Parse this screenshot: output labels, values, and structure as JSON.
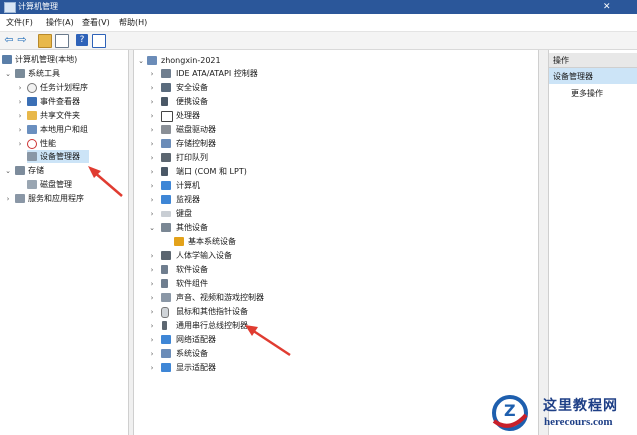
{
  "window": {
    "title": "计算机管理"
  },
  "menu": [
    "文件(F)",
    "操作(A)",
    "查看(V)",
    "帮助(H)"
  ],
  "toolbar": [
    "back-icon",
    "forward-icon",
    "up-folder-icon",
    "console-tree-icon",
    "help-icon",
    "properties-icon"
  ],
  "left_tree": [
    {
      "label": "计算机管理(本地)",
      "level": 0,
      "icon": "computer-management-icon"
    },
    {
      "label": "系统工具",
      "level": 1,
      "icon": "system-tools-icon",
      "expanded": true
    },
    {
      "label": "任务计划程序",
      "level": 2,
      "icon": "task-scheduler-icon"
    },
    {
      "label": "事件查看器",
      "level": 2,
      "icon": "event-viewer-icon"
    },
    {
      "label": "共享文件夹",
      "level": 2,
      "icon": "shared-folder-icon"
    },
    {
      "label": "本地用户和组",
      "level": 2,
      "icon": "users-icon"
    },
    {
      "label": "性能",
      "level": 2,
      "icon": "performance-icon"
    },
    {
      "label": "设备管理器",
      "level": 2,
      "icon": "device-manager-icon",
      "selected": true
    },
    {
      "label": "存储",
      "level": 1,
      "icon": "storage-icon",
      "expanded": true
    },
    {
      "label": "磁盘管理",
      "level": 2,
      "icon": "disk-management-icon"
    },
    {
      "label": "服务和应用程序",
      "level": 1,
      "icon": "services-icon"
    }
  ],
  "center_tree": [
    {
      "label": "zhongxin-2021",
      "level": 0,
      "icon": "computer-icon",
      "expanded": true
    },
    {
      "label": "IDE ATA/ATAPI 控制器",
      "level": 1,
      "icon": "ide-controller-icon"
    },
    {
      "label": "安全设备",
      "level": 1,
      "icon": "security-device-icon"
    },
    {
      "label": "便携设备",
      "level": 1,
      "icon": "portable-device-icon"
    },
    {
      "label": "处理器",
      "level": 1,
      "icon": "processor-icon"
    },
    {
      "label": "磁盘驱动器",
      "level": 1,
      "icon": "disk-drive-icon"
    },
    {
      "label": "存储控制器",
      "level": 1,
      "icon": "storage-controller-icon"
    },
    {
      "label": "打印队列",
      "level": 1,
      "icon": "printer-icon"
    },
    {
      "label": "端口 (COM 和 LPT)",
      "level": 1,
      "icon": "port-icon"
    },
    {
      "label": "计算机",
      "level": 1,
      "icon": "computer-icon"
    },
    {
      "label": "监视器",
      "level": 1,
      "icon": "monitor-icon"
    },
    {
      "label": "键盘",
      "level": 1,
      "icon": "keyboard-icon"
    },
    {
      "label": "其他设备",
      "level": 1,
      "icon": "other-devices-icon",
      "expanded": true
    },
    {
      "label": "基本系统设备",
      "level": 2,
      "icon": "warning-device-icon"
    },
    {
      "label": "人体学输入设备",
      "level": 1,
      "icon": "hid-icon"
    },
    {
      "label": "软件设备",
      "level": 1,
      "icon": "software-device-icon"
    },
    {
      "label": "软件组件",
      "level": 1,
      "icon": "software-component-icon"
    },
    {
      "label": "声音、视频和游戏控制器",
      "level": 1,
      "icon": "sound-icon"
    },
    {
      "label": "鼠标和其他指针设备",
      "level": 1,
      "icon": "mouse-icon"
    },
    {
      "label": "通用串行总线控制器",
      "level": 1,
      "icon": "usb-icon"
    },
    {
      "label": "网络适配器",
      "level": 1,
      "icon": "network-adapter-icon"
    },
    {
      "label": "系统设备",
      "level": 1,
      "icon": "system-device-icon"
    },
    {
      "label": "显示适配器",
      "level": 1,
      "icon": "display-adapter-icon"
    }
  ],
  "actions": {
    "header": "操作",
    "section": "设备管理器",
    "more": "更多操作"
  },
  "watermark": {
    "logo_text": "Z",
    "site_name": "这里教程网",
    "url": "herecours.com"
  },
  "colors": {
    "titlebar": "#2b579a",
    "selection": "#cce4f7",
    "annotation_arrow": "#e03c31"
  }
}
